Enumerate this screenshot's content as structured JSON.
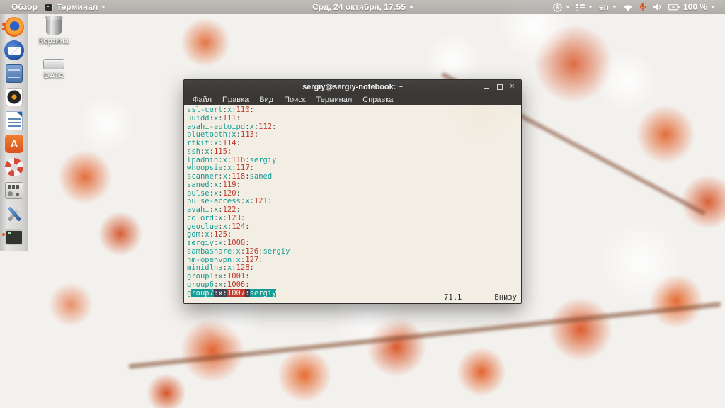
{
  "topbar": {
    "activities": "Обзор",
    "app_name": "Терминал",
    "clock": "Срд, 24 октября, 17:55",
    "language": "en",
    "battery": "100 %"
  },
  "desktop": {
    "trash_label": "Корзина",
    "disk_label": "DATA"
  },
  "dock": {
    "software_glyph": "A",
    "items": [
      "firefox",
      "thunderbird",
      "files",
      "sound-recorder",
      "libreoffice-writer",
      "ubuntu-software",
      "help",
      "audio-mixer",
      "tweaks",
      "terminal"
    ]
  },
  "terminal": {
    "title": "sergiy@sergiy-notebook: ~",
    "menu": [
      "Файл",
      "Правка",
      "Вид",
      "Поиск",
      "Терминал",
      "Справка"
    ],
    "close_glyph": "×",
    "groups": [
      {
        "name": "ssl-cert",
        "pw": "x",
        "gid": "110",
        "members": ""
      },
      {
        "name": "uuidd",
        "pw": "x",
        "gid": "111",
        "members": ""
      },
      {
        "name": "avahi-autoipd",
        "pw": "x",
        "gid": "112",
        "members": ""
      },
      {
        "name": "bluetooth",
        "pw": "x",
        "gid": "113",
        "members": ""
      },
      {
        "name": "rtkit",
        "pw": "x",
        "gid": "114",
        "members": ""
      },
      {
        "name": "ssh",
        "pw": "x",
        "gid": "115",
        "members": ""
      },
      {
        "name": "lpadmin",
        "pw": "x",
        "gid": "116",
        "members": "sergiy"
      },
      {
        "name": "whoopsie",
        "pw": "x",
        "gid": "117",
        "members": ""
      },
      {
        "name": "scanner",
        "pw": "x",
        "gid": "118",
        "members": "saned"
      },
      {
        "name": "saned",
        "pw": "x",
        "gid": "119",
        "members": ""
      },
      {
        "name": "pulse",
        "pw": "x",
        "gid": "120",
        "members": ""
      },
      {
        "name": "pulse-access",
        "pw": "x",
        "gid": "121",
        "members": ""
      },
      {
        "name": "avahi",
        "pw": "x",
        "gid": "122",
        "members": ""
      },
      {
        "name": "colord",
        "pw": "x",
        "gid": "123",
        "members": ""
      },
      {
        "name": "geoclue",
        "pw": "x",
        "gid": "124",
        "members": ""
      },
      {
        "name": "gdm",
        "pw": "x",
        "gid": "125",
        "members": ""
      },
      {
        "name": "sergiy",
        "pw": "x",
        "gid": "1000",
        "members": ""
      },
      {
        "name": "sambashare",
        "pw": "x",
        "gid": "126",
        "members": "sergiy"
      },
      {
        "name": "nm-openvpn",
        "pw": "x",
        "gid": "127",
        "members": ""
      },
      {
        "name": "minidlna",
        "pw": "x",
        "gid": "128",
        "members": ""
      },
      {
        "name": "group1",
        "pw": "x",
        "gid": "1001",
        "members": ""
      },
      {
        "name": "group6",
        "pw": "x",
        "gid": "1006",
        "members": ""
      },
      {
        "name": "group7",
        "pw": "x",
        "gid": "1007",
        "members": "sergiy",
        "selected": true
      }
    ],
    "status": {
      "ruler": "71,1",
      "position": "Внизу"
    }
  },
  "colors": {
    "teal": "#149d96",
    "red": "#bc3b2e",
    "terminal_bg": "#f2ede3",
    "titlebar_bg": "#3a3836",
    "accent_orange": "#e0551c"
  }
}
